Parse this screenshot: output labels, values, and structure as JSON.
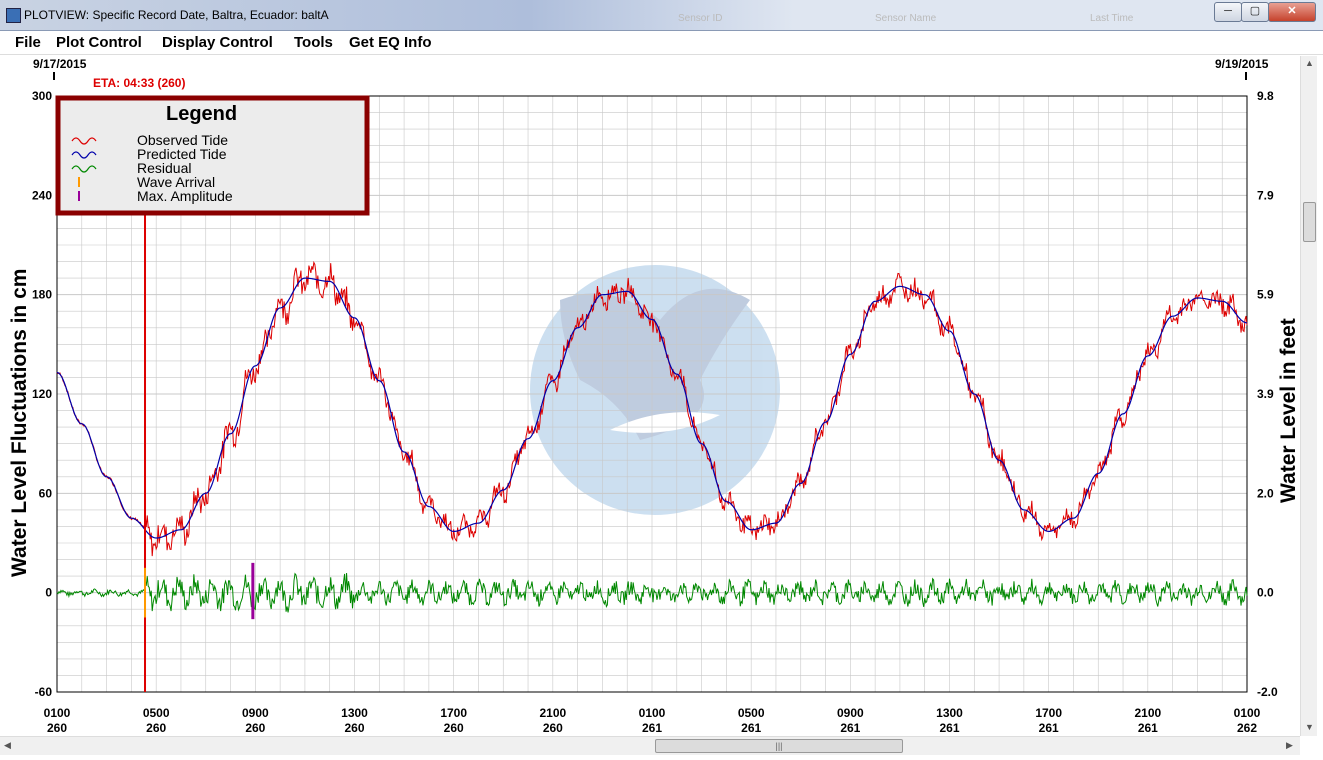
{
  "window": {
    "title": "PLOTVIEW: Specific Record Date, Baltra, Ecuador: baltA",
    "ghost_columns": [
      "Sensor ID",
      "Sensor Name",
      "Last Time"
    ],
    "controls": {
      "minimize": "─",
      "maximize": "▢",
      "close": "✕"
    }
  },
  "menu": {
    "items": [
      "File",
      "Plot Control",
      "Display Control",
      "Tools",
      "Get EQ Info"
    ]
  },
  "plot": {
    "start_date": "9/17/2015",
    "end_date": "9/19/2015",
    "eta_label": "ETA: 04:33 (260)",
    "hscroll_grip": "|||"
  },
  "colors": {
    "observed": "#dd0000",
    "predicted": "#0000aa",
    "residual": "#008800",
    "wave_arrival": "#ff9900",
    "max_amplitude": "#990099",
    "eta_line": "#dd0000",
    "legend_border": "#8b0000",
    "grid": "#c8c8c8"
  },
  "chart_data": {
    "type": "line",
    "ylabel": "Water Level Fluctuations in cm",
    "y2label": "Water Level in feet",
    "ylim": [
      -60,
      300
    ],
    "y_ticks": [
      300,
      240,
      180,
      120,
      60,
      0,
      -60
    ],
    "y2_ticks": [
      "9.8",
      "7.9",
      "5.9",
      "3.9",
      "2.0",
      "0.0",
      "-2.0"
    ],
    "x_ticks": [
      {
        "time": "0100",
        "day": "260"
      },
      {
        "time": "0500",
        "day": "260"
      },
      {
        "time": "0900",
        "day": "260"
      },
      {
        "time": "1300",
        "day": "260"
      },
      {
        "time": "1700",
        "day": "260"
      },
      {
        "time": "2100",
        "day": "260"
      },
      {
        "time": "0100",
        "day": "261"
      },
      {
        "time": "0500",
        "day": "261"
      },
      {
        "time": "0900",
        "day": "261"
      },
      {
        "time": "1300",
        "day": "261"
      },
      {
        "time": "1700",
        "day": "261"
      },
      {
        "time": "2100",
        "day": "261"
      },
      {
        "time": "0100",
        "day": "262"
      }
    ],
    "x_hours_range": [
      0,
      48
    ],
    "legend": {
      "title": "Legend",
      "entries": [
        "Observed Tide",
        "Predicted Tide",
        "Residual",
        "Wave Arrival",
        "Max. Amplitude"
      ],
      "placement": "top-left"
    },
    "eta_hour": 3.55,
    "wave_arrival_hour": 3.55,
    "max_amplitude_hour": 7.9,
    "series": [
      {
        "name": "Predicted Tide",
        "x_hours": [
          0,
          1,
          2,
          3,
          4,
          5,
          6,
          7,
          8,
          9,
          10,
          11,
          12,
          13,
          14,
          15,
          16,
          17,
          18,
          19,
          20,
          21,
          22,
          23,
          24,
          25,
          26,
          27,
          28,
          29,
          30,
          31,
          32,
          33,
          34,
          35,
          36,
          37,
          38,
          39,
          40,
          41,
          42,
          43,
          44,
          45,
          46,
          47,
          48
        ],
        "values": [
          133,
          102,
          70,
          45,
          33,
          38,
          60,
          96,
          137,
          172,
          190,
          188,
          166,
          128,
          85,
          52,
          37,
          42,
          62,
          93,
          128,
          160,
          180,
          182,
          165,
          132,
          90,
          55,
          38,
          42,
          66,
          103,
          144,
          176,
          185,
          180,
          158,
          120,
          80,
          50,
          37,
          45,
          72,
          108,
          143,
          167,
          178,
          176,
          163
        ]
      }
    ],
    "observed_noise_cm": 8,
    "residual_amplitude_cm": 14
  }
}
